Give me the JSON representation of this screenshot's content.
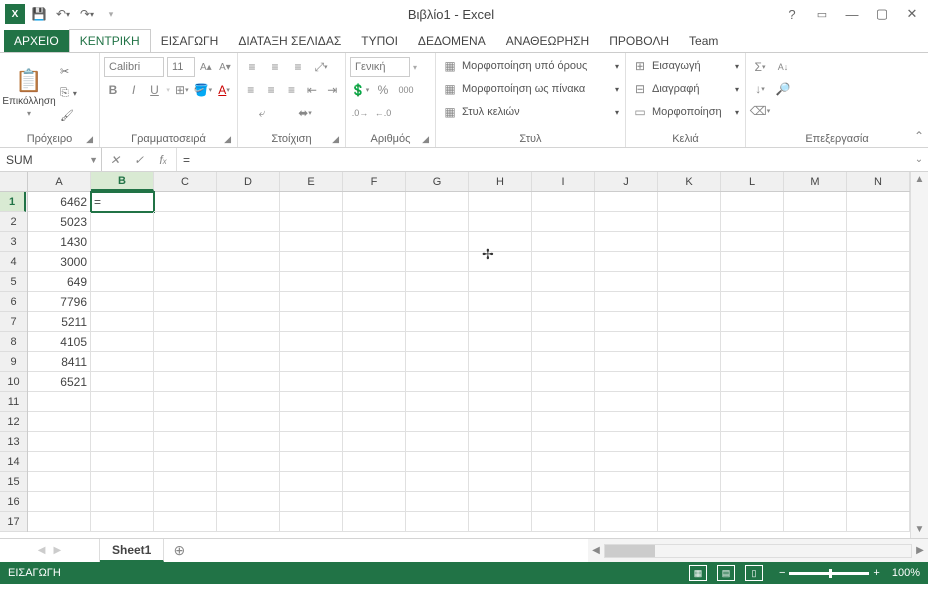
{
  "title": "Βιβλίο1 - Excel",
  "qat": {
    "save": "save",
    "undo": "undo",
    "redo": "redo"
  },
  "tabs": {
    "file": "ΑΡΧΕΙΟ",
    "home": "ΚΕΝΤΡΙΚΗ",
    "insert": "ΕΙΣΑΓΩΓΗ",
    "layout": "ΔΙΑΤΑΞΗ ΣΕΛΙΔΑΣ",
    "formulas": "ΤΥΠΟΙ",
    "data": "ΔΕΔΟΜΕΝΑ",
    "review": "ΑΝΑΘΕΩΡΗΣΗ",
    "view": "ΠΡΟΒΟΛΗ",
    "team": "Team"
  },
  "ribbon": {
    "clipboard": {
      "label": "Πρόχειρο",
      "paste": "Επικόλληση"
    },
    "font": {
      "label": "Γραμματοσειρά",
      "name": "Calibri",
      "size": "11",
      "b": "B",
      "i": "I",
      "u": "U"
    },
    "align": {
      "label": "Στοίχιση"
    },
    "number": {
      "label": "Αριθμός",
      "fmt": "Γενική"
    },
    "styles": {
      "label": "Στυλ",
      "cond": "Μορφοποίηση υπό όρους",
      "table": "Μορφοποίηση ως πίνακα",
      "cell": "Στυλ κελιών"
    },
    "cells": {
      "label": "Κελιά",
      "insert": "Εισαγωγή",
      "delete": "Διαγραφή",
      "format": "Μορφοποίηση"
    },
    "editing": {
      "label": "Επεξεργασία"
    }
  },
  "namebox": "SUM",
  "formula": "=",
  "columns": [
    "A",
    "B",
    "C",
    "D",
    "E",
    "F",
    "G",
    "H",
    "I",
    "J",
    "K",
    "L",
    "M",
    "N"
  ],
  "active_col": "B",
  "active_row": 1,
  "rows": 17,
  "data_a": [
    "6462",
    "5023",
    "1430",
    "3000",
    "649",
    "7796",
    "5211",
    "4105",
    "8411",
    "6521"
  ],
  "b1": "=",
  "sheet": {
    "name": "Sheet1"
  },
  "status": {
    "mode": "ΕΙΣΑΓΩΓΗ",
    "zoom": "100%"
  }
}
